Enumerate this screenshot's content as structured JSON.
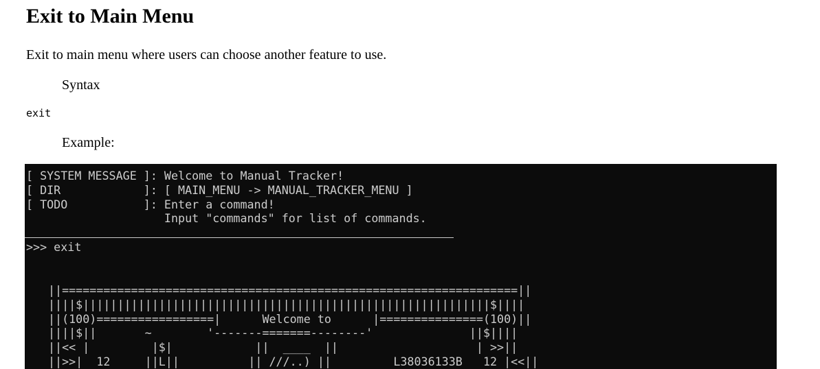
{
  "page": {
    "title": "Exit to Main Menu",
    "description": "Exit to main menu where users can choose another feature to use.",
    "syntax_label": "Syntax",
    "syntax_code": "exit",
    "example_label": "Example:"
  },
  "terminal": {
    "header_lines": "[ SYSTEM MESSAGE ]: Welcome to Manual Tracker!\n[ DIR            ]: [ MAIN_MENU -> MANUAL_TRACKER_MENU ]\n[ TODO           ]: Enter a command!\n                    Input \"commands\" for list of commands.",
    "prompt_line": ">>> exit",
    "banner_art": "||==================================================================||\n||||$|||||||||||||||||||||||||||||||||||||||||||||||||||||||||||$||||\n||(100)=================|      Welcome to      |===============(100)||\n||||$||       ~        '-------=======--------'              ||$||||\n||<< |         |$|            ||  ____  ||                    | >>||\n||>>|  12     ||L||          || ///..) ||         L38036133B   12 |<<||"
  }
}
